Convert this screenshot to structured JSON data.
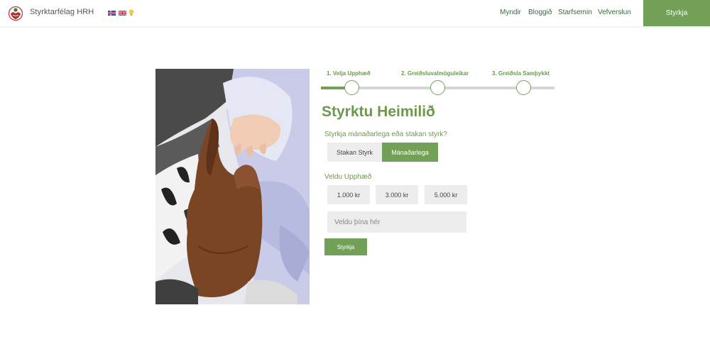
{
  "header": {
    "brand": "Styrktarfélag HRH",
    "nav": [
      "Myndir",
      "Bloggið",
      "Starfsemin",
      "Vefverslun"
    ],
    "cta": "Styrkja",
    "flags": [
      "flag-iceland-icon",
      "flag-uk-icon",
      "lightbulb-icon"
    ],
    "accent_color": "#72a057"
  },
  "steps": {
    "items": [
      "1. Velja Upphæð",
      "2. Greiðsluvalmöguleikar",
      "3. Greiðsla Samþykkt"
    ],
    "current": 1,
    "progress": 0.13
  },
  "form": {
    "title": "Styrktu Heimilið",
    "frequency_label": "Styrkja mánaðarlega eða stakan styrk?",
    "frequency_options": [
      "Stakan Styrk",
      "Mánaðarlega"
    ],
    "frequency_selected": "Mánaðarlega",
    "amount_label": "Veldu Upphæð",
    "amounts": [
      "1.000 kr",
      "3.000 kr",
      "5.000 kr"
    ],
    "custom_placeholder": "Veldu þína hér",
    "submit": "Styrkja"
  }
}
